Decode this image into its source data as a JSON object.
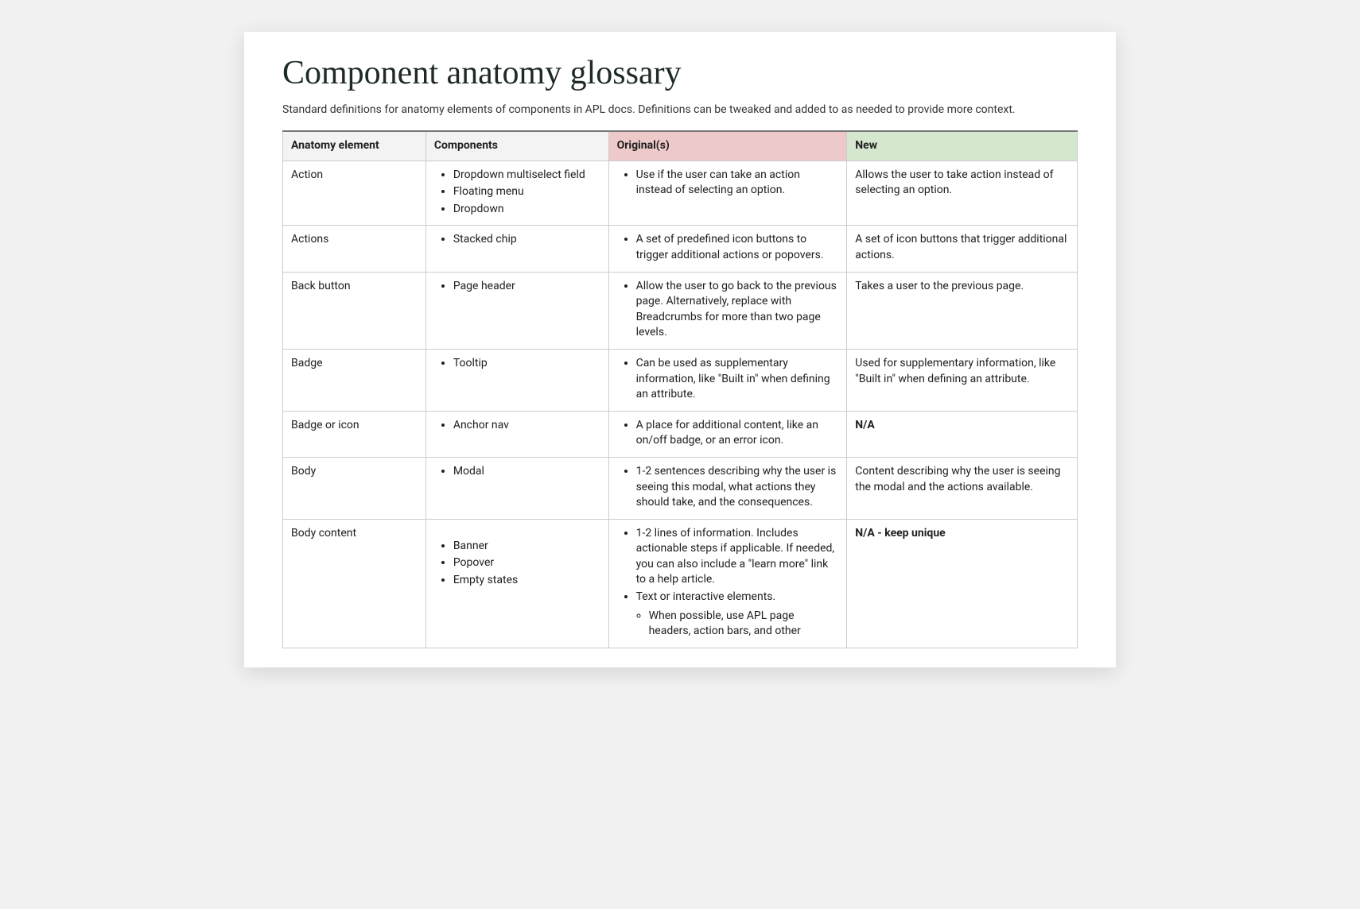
{
  "title": "Component anatomy glossary",
  "subtitle": "Standard definitions for anatomy elements of components in APL docs. Definitions can be tweaked and added to as needed to provide more context.",
  "headers": {
    "anatomy": "Anatomy element",
    "components": "Components",
    "original": "Original(s)",
    "new": "New"
  },
  "rows": [
    {
      "anatomy": "Action",
      "components": [
        "Dropdown multiselect field",
        "Floating menu",
        "Dropdown"
      ],
      "original": [
        "Use if the user can take an action instead of selecting an option."
      ],
      "new": "Allows the user to take action instead of selecting an option.",
      "new_bold": false
    },
    {
      "anatomy": "Actions",
      "components": [
        "Stacked chip"
      ],
      "original": [
        "A set of predefined icon buttons to trigger additional actions or popovers."
      ],
      "new": "A set of icon buttons that trigger additional actions.",
      "new_bold": false
    },
    {
      "anatomy": "Back button",
      "components": [
        "Page header"
      ],
      "original": [
        "Allow the user to go back to the previous page. Alternatively, replace with Breadcrumbs for more than two page levels."
      ],
      "new": "Takes a user to the previous page.",
      "new_bold": false
    },
    {
      "anatomy": "Badge",
      "components": [
        "Tooltip"
      ],
      "original": [
        "Can be used as supplementary information, like \"Built in\" when defining an attribute."
      ],
      "new": "Used for supplementary information, like \"Built in\" when defining an attribute.",
      "new_bold": false
    },
    {
      "anatomy": "Badge or icon",
      "components": [
        "Anchor nav"
      ],
      "original": [
        "A place for additional content, like an on/off badge, or an error icon."
      ],
      "new": "N/A",
      "new_bold": true
    },
    {
      "anatomy": "Body",
      "components": [
        "Modal"
      ],
      "original": [
        " 1-2 sentences describing why the user is seeing this modal, what actions they should take, and the consequences."
      ],
      "new": "Content describing why the user is seeing the modal and the actions available.",
      "new_bold": false
    },
    {
      "anatomy": "Body content",
      "components_delayed": [
        "Banner",
        "Popover",
        "Empty states"
      ],
      "original": [
        "1-2 lines of information. Includes actionable steps if applicable. If needed, you can also include a \"learn more\" link to a help article.",
        "Text or interactive elements."
      ],
      "original_sub": [
        "When possible, use APL page headers, action bars, and other"
      ],
      "new": "N/A - keep unique",
      "new_bold": true
    }
  ]
}
